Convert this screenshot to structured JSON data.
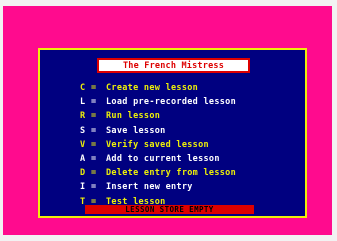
{
  "screen": {
    "title": "The French Mistress",
    "border_color": "#ff0b8e",
    "paper_color": "#000080",
    "frame_color": "#eef008",
    "title_color": "#dd0000"
  },
  "menu": [
    {
      "key": "C",
      "label": "Create new lesson",
      "color": "yellow"
    },
    {
      "key": "L",
      "label": "Load pre-recorded lesson",
      "color": "white"
    },
    {
      "key": "R",
      "label": "Run lesson",
      "color": "yellow"
    },
    {
      "key": "S",
      "label": "Save lesson",
      "color": "white"
    },
    {
      "key": "V",
      "label": "Verify saved lesson",
      "color": "yellow"
    },
    {
      "key": "A",
      "label": "Add to current lesson",
      "color": "white"
    },
    {
      "key": "D",
      "label": "Delete entry from lesson",
      "color": "yellow"
    },
    {
      "key": "I",
      "label": "Insert new entry",
      "color": "white"
    },
    {
      "key": "T",
      "label": "Test lesson",
      "color": "yellow"
    }
  ],
  "status": {
    "text": "LESSON STORE EMPTY"
  }
}
